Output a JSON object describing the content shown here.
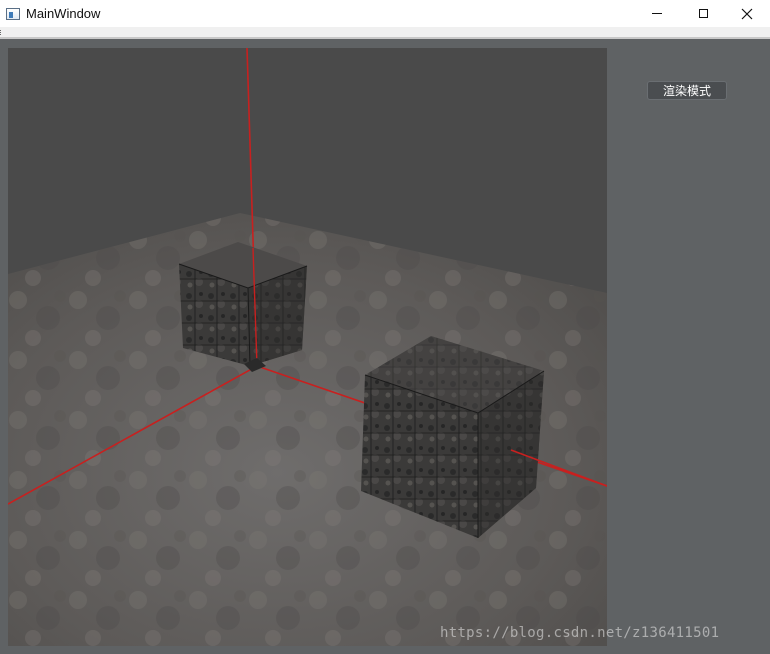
{
  "window": {
    "title": "MainWindow",
    "icon": "app-window-icon",
    "controls": [
      "minimize-icon",
      "maximize-icon",
      "close-icon"
    ]
  },
  "sidebar": {
    "render_mode_button": "渲染模式"
  },
  "viewport": {
    "scene": "3d-scene-two-textured-cubes-on-stone-floor-with-red-axes",
    "colors": {
      "sky": "#4a4a4a",
      "floor": "#6b6866",
      "cube": "#3a3938",
      "axis": "#c8201f"
    }
  },
  "watermark": "https://blog.csdn.net/z136411501"
}
